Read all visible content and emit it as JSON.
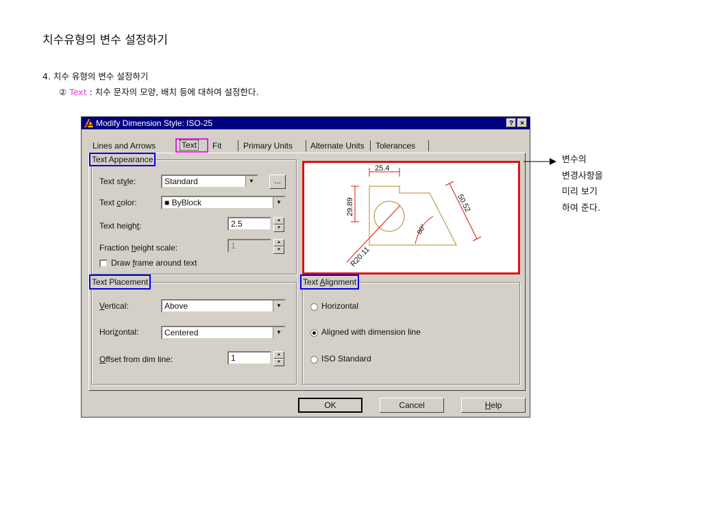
{
  "page": {
    "title": "치수유형의 변수 설정하기",
    "section": "4. 치수 유형의 변수 설정하기",
    "subtitle_prefix": "② ",
    "subtitle_keyword": "Text",
    "subtitle_rest": " : 치수 문자의 모양, 배치 등에 대하여 설정한다."
  },
  "dialog": {
    "title": "Modify Dimension Style: ISO-25",
    "help_btn": "?",
    "close_btn": "×",
    "tabs": [
      "Lines and Arrows",
      "Text",
      "Fit",
      "Primary Units",
      "Alternate Units",
      "Tolerances"
    ],
    "active_tab": "Text",
    "text_appearance": {
      "legend": "Text Appearance",
      "style_label_a": "Text st",
      "style_label_u": "y",
      "style_label_b": "le:",
      "style_value": "Standard",
      "style_browse": "...",
      "color_label_a": "Text ",
      "color_label_u": "c",
      "color_label_b": "olor:",
      "color_swatch": "■",
      "color_value": "ByBlock",
      "height_label_a": "Text heigh",
      "height_label_u": "t",
      "height_label_b": ":",
      "height_value": "2.5",
      "fraction_label_a": "Fraction ",
      "fraction_label_u": "h",
      "fraction_label_b": "eight scale:",
      "fraction_value": "1",
      "frame_label_a": "Draw ",
      "frame_label_u": "f",
      "frame_label_b": "rame around text",
      "frame_checked": false
    },
    "text_placement": {
      "legend": "Text Placement",
      "vertical_label_u": "V",
      "vertical_label_b": "ertical:",
      "vertical_value": "Above",
      "horizontal_label_a": "Hori",
      "horizontal_label_u": "z",
      "horizontal_label_b": "ontal:",
      "horizontal_value": "Centered",
      "offset_label_u": "O",
      "offset_label_b": "ffset from dim line:",
      "offset_value": "1"
    },
    "text_alignment": {
      "legend_a": "Text ",
      "legend_u": "A",
      "legend_b": "lignment",
      "options": [
        "Horizontal",
        "Aligned with dimension line",
        "ISO Standard"
      ],
      "selected": "Aligned with dimension line"
    },
    "preview": {
      "dim_top": "25.4",
      "dim_left": "29.89",
      "dim_right": "50.52",
      "dim_angle": "80°",
      "dim_radius": "R20.11"
    },
    "buttons": {
      "ok": "OK",
      "cancel": "Cancel",
      "help_u": "H",
      "help_b": "elp"
    }
  },
  "side_note": [
    "변수의",
    "변경사항을",
    "미리 보기",
    "하여 준다."
  ],
  "colors": {
    "titlebar": "#000080",
    "dialog_bg": "#d4d0c8",
    "highlight_blue": "#0000e6",
    "highlight_magenta": "#e020e0",
    "highlight_red": "#e01010",
    "keyword": "#e040e0",
    "preview_geometry": "#b08a20",
    "preview_dims": "#e01010"
  }
}
